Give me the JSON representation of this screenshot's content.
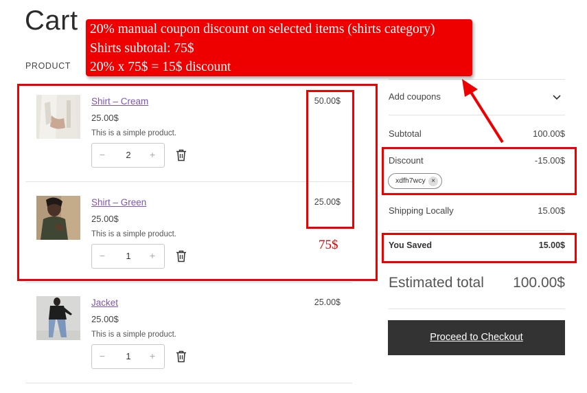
{
  "page": {
    "title": "Cart"
  },
  "table": {
    "product_header": "PRODUCT"
  },
  "annotation": {
    "lines": [
      "20% manual coupon discount on selected items (shirts category)",
      "Shirts subtotal: 75$",
      "20% x 75$ = 15$ discount"
    ],
    "shirts_total": "75$",
    "highlight_color": "#ee0000"
  },
  "items": [
    {
      "name": "Shirt – Cream",
      "unit_price": "25.00$",
      "description": "This is a simple product.",
      "quantity": "2",
      "line_total": "50.00$",
      "image": "cream-shirt-photo"
    },
    {
      "name": "Shirt – Green",
      "unit_price": "25.00$",
      "description": "This is a simple product.",
      "quantity": "1",
      "line_total": "25.00$",
      "image": "green-shirt-photo"
    },
    {
      "name": "Jacket",
      "unit_price": "25.00$",
      "description": "This is a simple product.",
      "quantity": "1",
      "line_total": "25.00$",
      "image": "jacket-photo"
    }
  ],
  "quantity_controls": {
    "minus": "−",
    "plus": "+"
  },
  "totals": {
    "coupons_label": "Add coupons",
    "subtotal_label": "Subtotal",
    "subtotal_value": "100.00$",
    "discount_label": "Discount",
    "discount_value": "-15.00$",
    "coupon_code": "xdfh7wcy",
    "coupon_remove": "×",
    "shipping_label": "Shipping Locally",
    "shipping_value": "15.00$",
    "saved_label": "You Saved",
    "saved_value": "15.00$",
    "estimated_label": "Estimated total",
    "estimated_value": "100.00$",
    "checkout_label": "Proceed to Checkout"
  },
  "colors": {
    "link": "#7f54b3",
    "button_bg": "#333333",
    "annotation_red": "#ee0000"
  }
}
